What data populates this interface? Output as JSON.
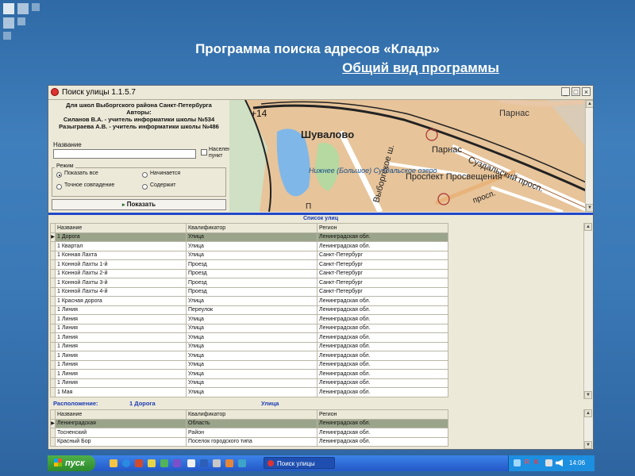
{
  "slide": {
    "title": "Программа поиска адресов «Кладр»",
    "subtitle": "Общий вид программы"
  },
  "window": {
    "title": "Поиск улицы 1.1.5.7",
    "controls": [
      "_",
      "□",
      "×"
    ]
  },
  "panel": {
    "authors": [
      "Для школ Выборгского района Санкт-Петербурга",
      "Авторы:",
      "Силанов В.А. - учитель информатики школы №534",
      "Разыграева А.В. - учитель информатики школы №486"
    ],
    "name_label": "Название",
    "name_value": "",
    "settlement_label": "Населенный пункт",
    "settlement_checked": false,
    "mode_label": "Режим",
    "modes": [
      {
        "label": "Показать все",
        "selected": true
      },
      {
        "label": "Начинается",
        "selected": false
      },
      {
        "label": "Точное совпадение",
        "selected": false
      },
      {
        "label": "Содержит",
        "selected": false
      }
    ],
    "show_button": "Показать"
  },
  "map": {
    "labels": [
      "+14",
      "Парнас",
      "Шувалово",
      "Парнас",
      "Нижнее (Большое) Суздальское озеро",
      "Выборгское ш.",
      "Проспект Просвещения",
      "Суздальский просп.",
      "просп.",
      "П"
    ]
  },
  "streets": {
    "caption": "Список улиц",
    "columns": [
      "Название",
      "Квалификатор",
      "Регион"
    ],
    "rows": [
      [
        "1 Дорога",
        "Улица",
        "Ленинградская обл."
      ],
      [
        "1 Квартал",
        "Улица",
        "Ленинградская обл."
      ],
      [
        "1 Конная Лахта",
        "Улица",
        "Санкт-Петербург"
      ],
      [
        "1 Конной Лахты 1-й",
        "Проезд",
        "Санкт-Петербург"
      ],
      [
        "1 Конной Лахты 2-й",
        "Проезд",
        "Санкт-Петербург"
      ],
      [
        "1 Конной Лахты 3-й",
        "Проезд",
        "Санкт-Петербург"
      ],
      [
        "1 Конной Лахты 4-й",
        "Проезд",
        "Санкт-Петербург"
      ],
      [
        "1 Красная дорога",
        "Улица",
        "Ленинградская обл."
      ],
      [
        "1 Линия",
        "Переулок",
        "Ленинградская обл."
      ],
      [
        "1 Линия",
        "Улица",
        "Ленинградская обл."
      ],
      [
        "1 Линия",
        "Улица",
        "Ленинградская обл."
      ],
      [
        "1 Линия",
        "Улица",
        "Ленинградская обл."
      ],
      [
        "1 Линия",
        "Улица",
        "Ленинградская обл."
      ],
      [
        "1 Линия",
        "Улица",
        "Ленинградская обл."
      ],
      [
        "1 Линия",
        "Улица",
        "Ленинградская обл."
      ],
      [
        "1 Линия",
        "Улица",
        "Ленинградская обл."
      ],
      [
        "1 Линия",
        "Улица",
        "Ленинградская обл."
      ],
      [
        "1 Мая",
        "Улица",
        "Ленинградская обл."
      ]
    ],
    "selected_index": 0
  },
  "location": {
    "label": "Расположение:",
    "street": "1 Дорога",
    "type": "Улица",
    "columns": [
      "Название",
      "Квалификатор",
      "Регион"
    ],
    "rows": [
      [
        "Ленинградская",
        "Область",
        "Ленинградская обл."
      ],
      [
        "Тосненский",
        "Район",
        "Ленинградская обл."
      ],
      [
        "Красный Бор",
        "Поселок городского типа",
        "Ленинградская обл."
      ]
    ]
  },
  "taskbar": {
    "start_label": "пуск",
    "task_label": "Поиск улицы",
    "tray_letters": [
      "R",
      "K"
    ],
    "clock": "14:06"
  },
  "colors": {
    "background": "#3a78b6",
    "accent_bar": "#2248c7",
    "selected_row": "#9aa48a",
    "caption_text": "#1b3bb5"
  }
}
